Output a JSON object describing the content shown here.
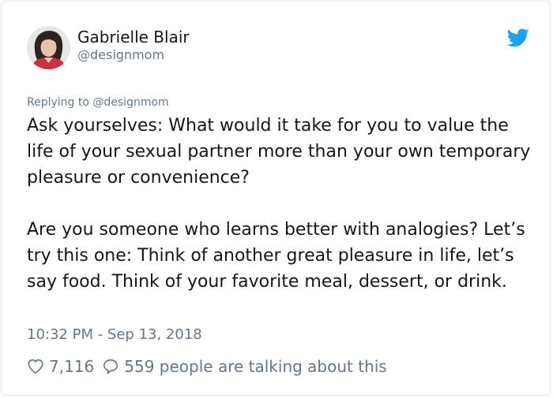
{
  "author": {
    "name": "Gabrielle Blair",
    "handle": "@designmom",
    "avatar_icon": "avatar-photo"
  },
  "brand": {
    "icon": "twitter-bird-icon",
    "color": "#1da1f2"
  },
  "reply_context": {
    "prefix": "Replying to",
    "handle": "@designmom"
  },
  "tweet": {
    "paragraphs": [
      "Ask yourselves: What would it take for you to value the life of your sexual partner more than your own temporary pleasure or convenience?",
      "Are you someone who learns better with analogies? Let’s try this one: Think of another great pleasure in life, let’s say food. Think of your favorite meal, dessert, or drink."
    ],
    "timestamp": "10:32 PM - Sep 13, 2018"
  },
  "engagement": {
    "likes": "7,116",
    "like_icon": "heart-icon",
    "reply_icon": "speech-bubble-icon",
    "talking_text": "559 people are talking about this"
  },
  "colors": {
    "text": "#14171a",
    "secondary": "#657786",
    "border": "#e1e8ed"
  }
}
